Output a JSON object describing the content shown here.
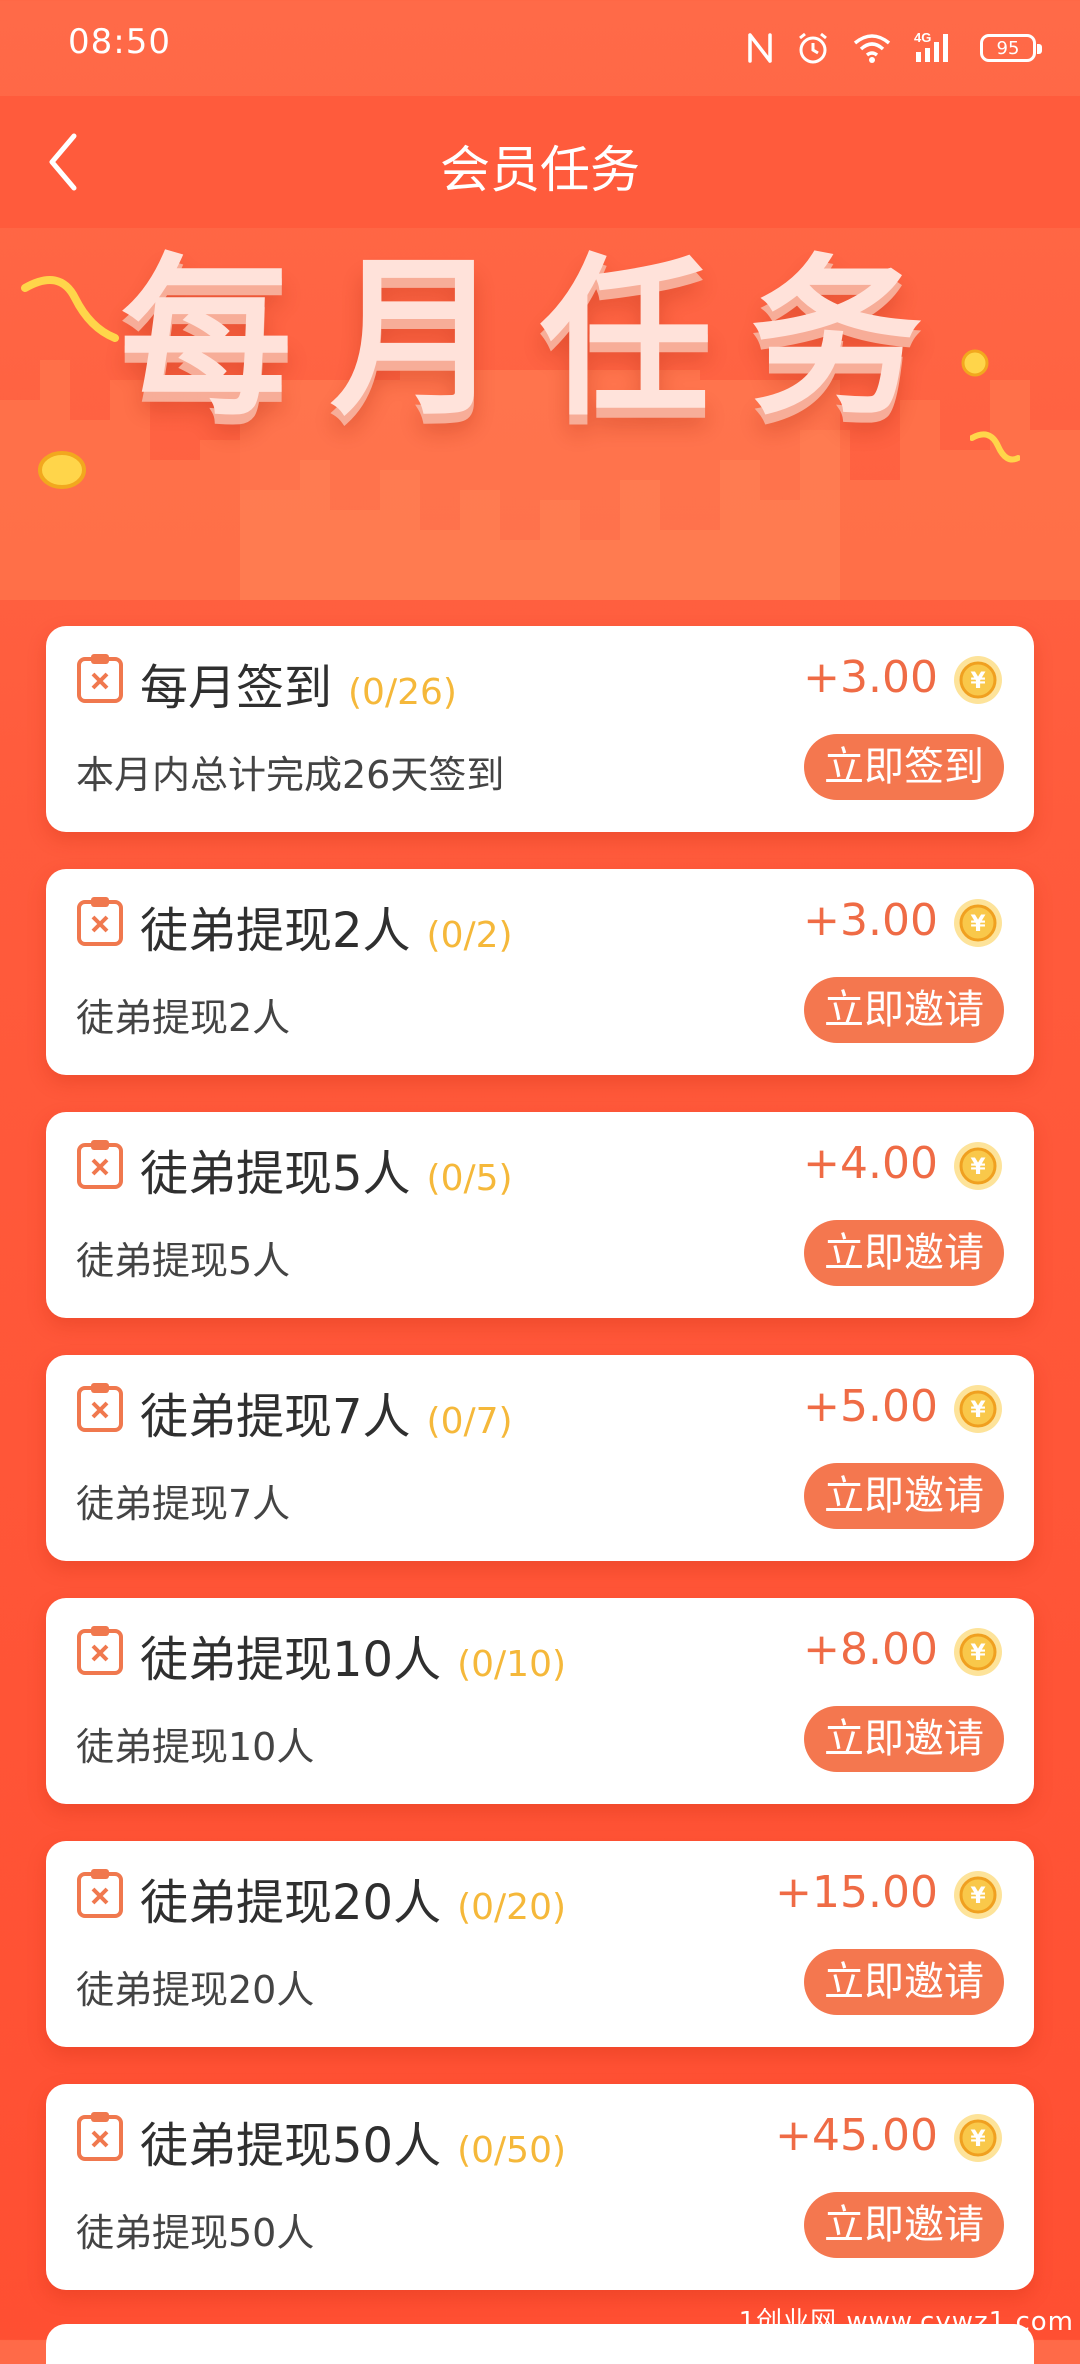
{
  "status_bar": {
    "time": "08:50",
    "battery": "95",
    "network": "4G"
  },
  "header": {
    "title": "会员任务"
  },
  "banner": {
    "title": "每月任务"
  },
  "tasks": [
    {
      "name": "每月签到",
      "progress": "(0/26)",
      "reward": "+3.00",
      "description": "本月内总计完成26天签到",
      "button": "立即签到"
    },
    {
      "name": "徒弟提现2人",
      "progress": "(0/2)",
      "reward": "+3.00",
      "description": "徒弟提现2人",
      "button": "立即邀请"
    },
    {
      "name": "徒弟提现5人",
      "progress": "(0/5)",
      "reward": "+4.00",
      "description": "徒弟提现5人",
      "button": "立即邀请"
    },
    {
      "name": "徒弟提现7人",
      "progress": "(0/7)",
      "reward": "+5.00",
      "description": "徒弟提现7人",
      "button": "立即邀请"
    },
    {
      "name": "徒弟提现10人",
      "progress": "(0/10)",
      "reward": "+8.00",
      "description": "徒弟提现10人",
      "button": "立即邀请"
    },
    {
      "name": "徒弟提现20人",
      "progress": "(0/20)",
      "reward": "+15.00",
      "description": "徒弟提现20人",
      "button": "立即邀请"
    },
    {
      "name": "徒弟提现50人",
      "progress": "(0/50)",
      "reward": "+45.00",
      "description": "徒弟提现50人",
      "button": "立即邀请"
    }
  ],
  "icons": {
    "task": "clipboard-x-icon",
    "coin": "yuan-coin-icon",
    "back": "chevron-left-icon"
  },
  "colors": {
    "accent": "#ff5b3c",
    "button": "#f4774f",
    "reward": "#ef6b45",
    "progress": "#f5b83a"
  },
  "watermark": "1创业网 www.cywz1.com"
}
